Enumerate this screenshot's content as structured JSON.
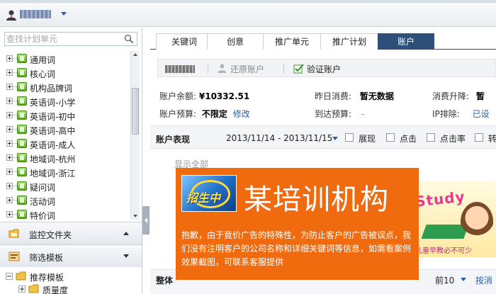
{
  "sidebar": {
    "search_placeholder": "查找计划单元",
    "tree_items": [
      {
        "label": "通用词"
      },
      {
        "label": "核心词"
      },
      {
        "label": "机构品牌词"
      },
      {
        "label": "英语词-小学"
      },
      {
        "label": "英语词-初中"
      },
      {
        "label": "英语词-高中"
      },
      {
        "label": "英语词-成人"
      },
      {
        "label": "地域词-杭州"
      },
      {
        "label": "地域词-浙江"
      },
      {
        "label": "疑问词"
      },
      {
        "label": "活动词"
      },
      {
        "label": "特价词"
      }
    ],
    "panels": {
      "monitor_label": "监控文件夹",
      "filter_label": "筛选模板"
    },
    "template_tree": {
      "root_label": "推荐模板",
      "child_label": "质量度"
    }
  },
  "tabs": [
    {
      "label": "关键词"
    },
    {
      "label": "创意"
    },
    {
      "label": "推广单元"
    },
    {
      "label": "推广计划"
    },
    {
      "label": "账户"
    }
  ],
  "account_toolbar": {
    "restore_label": "还原账户",
    "verify_label": "验证账户"
  },
  "account_info": {
    "balance_label": "账户余额:",
    "balance_value": "¥10332.51",
    "yesterday_label": "昨日消费:",
    "yesterday_value": "暂无数据",
    "upgrade_label": "消费升降:",
    "upgrade_value": "暂",
    "budget_label": "账户预算:",
    "budget_value": "不限定",
    "budget_edit": "修改",
    "reach_label": "到达预算:",
    "reach_value": "-",
    "ip_label": "IP排除:",
    "ip_value": "已设"
  },
  "performance": {
    "title": "账户表现",
    "date_range": "2013/11/14 - 2013/11/15",
    "options": [
      {
        "label": "展现"
      },
      {
        "label": "点击"
      },
      {
        "label": "点击率"
      },
      {
        "label": "转"
      }
    ],
    "show_all": "显示全部"
  },
  "overall": {
    "title": "整体",
    "top_n": "前10",
    "sort_by": "按消"
  },
  "ad": {
    "logo_text": "招生中",
    "title": "某培训机构",
    "message": "抱歉，由于竟价广告的特殊性，为防止客户的广告被误点，我们没有注明客户的公司名称和详细关键词等信息，如需看案例效果截图，可联系客服提供",
    "side_word": "Study",
    "side_caption": "儿童早教必不可少"
  }
}
